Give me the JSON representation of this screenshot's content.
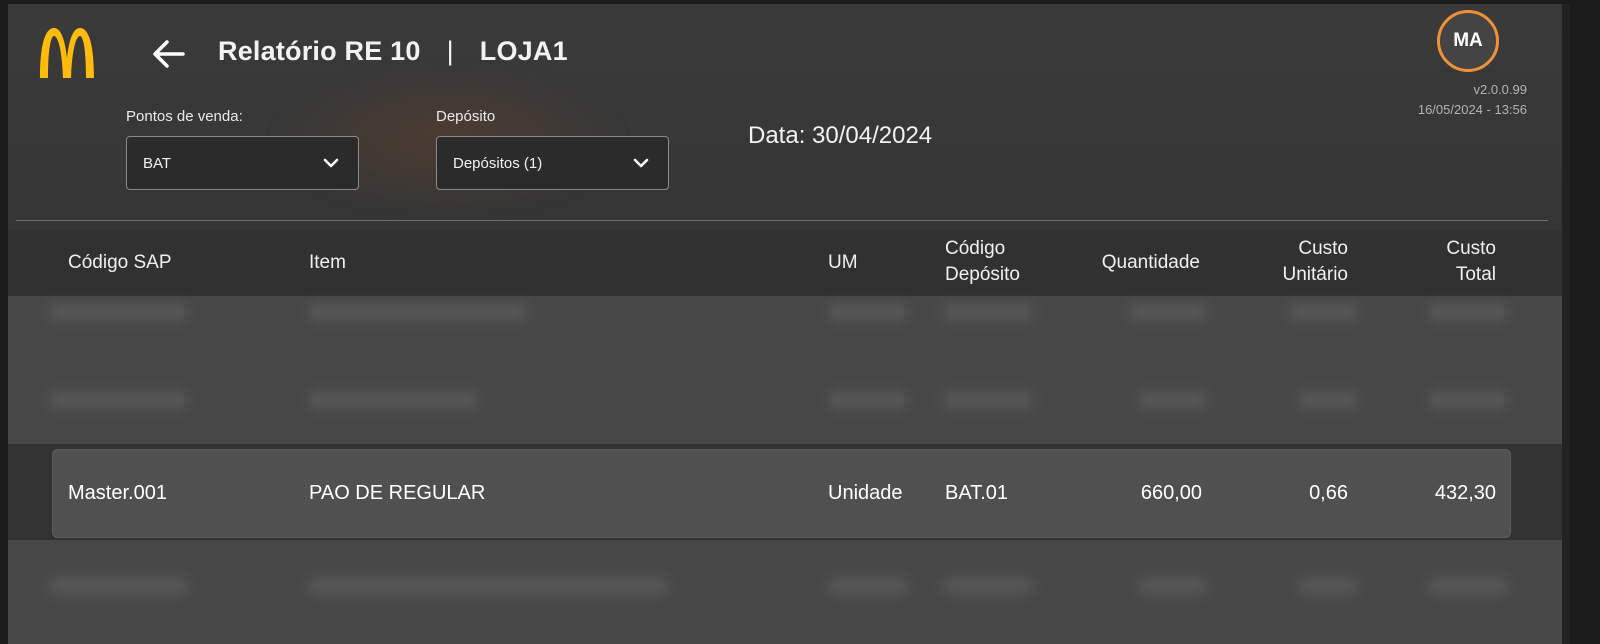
{
  "header": {
    "title": "Relatório RE 10",
    "separator": "|",
    "store": "LOJA1",
    "user_initials": "MA",
    "version": "v2.0.0.99",
    "datetime": "16/05/2024 - 13:56"
  },
  "filters": {
    "pos_label": "Pontos de venda:",
    "pos_value": "BAT",
    "deposit_label": "Depósito",
    "deposit_value": "Depósitos (1)",
    "date_text": "Data: 30/04/2024"
  },
  "table": {
    "columns": [
      {
        "line1": "Código SAP",
        "line2": ""
      },
      {
        "line1": "Item",
        "line2": ""
      },
      {
        "line1": "UM",
        "line2": ""
      },
      {
        "line1": "Código",
        "line2": "Depósito"
      },
      {
        "line1": "Quantidade",
        "line2": ""
      },
      {
        "line1": "Custo",
        "line2": "Unitário"
      },
      {
        "line1": "Custo",
        "line2": "Total"
      }
    ],
    "rows": [
      {
        "codigo_sap": "Master.001",
        "item": "PAO DE REGULAR",
        "um": "Unidade",
        "codigo_deposito": "BAT.01",
        "quantidade": "660,00",
        "custo_unitario": "0,66",
        "custo_total": "432,30"
      }
    ]
  },
  "colors": {
    "accent_avatar": "#f0913a",
    "logo_yellow": "#ffbc0d"
  },
  "icons": [
    "mcdonalds-logo",
    "back-arrow-icon",
    "chevron-down-icon"
  ]
}
